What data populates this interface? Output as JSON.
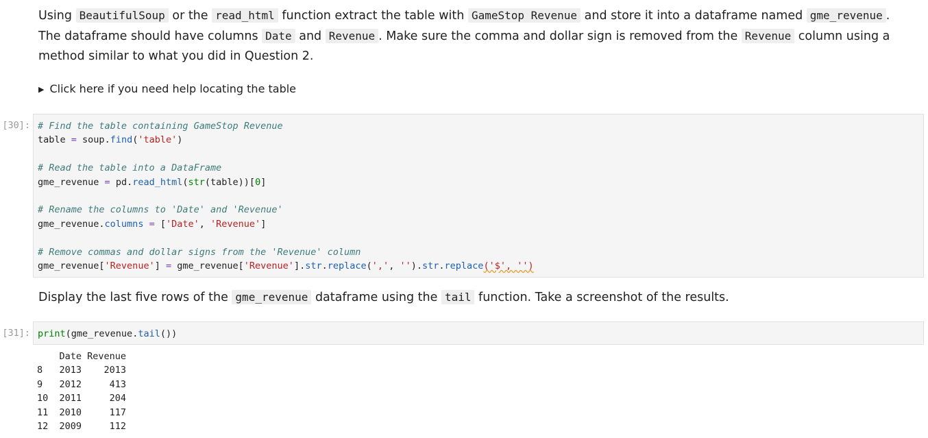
{
  "markdown1": {
    "t1": "Using ",
    "c1": "BeautifulSoup",
    "t2": " or the ",
    "c2": "read_html",
    "t3": " function extract the table with ",
    "c3": "GameStop Revenue",
    "t4": " and store it into a dataframe named ",
    "c4": "gme_revenue",
    "t5": ". The dataframe should have columns ",
    "c5": "Date",
    "t6": " and ",
    "c6": "Revenue",
    "t7": ". Make sure the comma and dollar sign is removed from the ",
    "c7": "Revenue",
    "t8": " column using a method similar to what you did in Question 2."
  },
  "details": {
    "summary": "Click here if you need help locating the table"
  },
  "cell30": {
    "prompt": "[30]:",
    "l1": "# Find the table containing GameStop Revenue",
    "l2a": "table ",
    "l2b": "=",
    "l2c": " soup",
    "l2d": ".",
    "l2e": "find",
    "l2f": "(",
    "l2g": "'table'",
    "l2h": ")",
    "l4": "# Read the table into a DataFrame",
    "l5a": "gme_revenue ",
    "l5b": "=",
    "l5c": " pd",
    "l5d": ".",
    "l5e": "read_html",
    "l5f": "(",
    "l5g": "str",
    "l5h": "(table))[",
    "l5i": "0",
    "l5j": "]",
    "l7": "# Rename the columns to 'Date' and 'Revenue'",
    "l8a": "gme_revenue",
    "l8b": ".",
    "l8c": "columns",
    "l8d": " = ",
    "l8e": "[",
    "l8f": "'Date'",
    "l8g": ", ",
    "l8h": "'Revenue'",
    "l8i": "]",
    "l10": "# Remove commas and dollar signs from the 'Revenue' column",
    "l11a": "gme_revenue[",
    "l11b": "'Revenue'",
    "l11c": "] ",
    "l11d": "=",
    "l11e": " gme_revenue[",
    "l11f": "'Revenue'",
    "l11g": "]",
    "l11h": ".",
    "l11i": "str",
    "l11j": ".",
    "l11k": "replace",
    "l11l": "(",
    "l11m": "','",
    "l11n": ", ",
    "l11o": "''",
    "l11p": ")",
    "l11q": ".",
    "l11r": "str",
    "l11s": ".",
    "l11t": "replace",
    "l11u": "('$', '')"
  },
  "markdown2": {
    "t1": "Display the last five rows of the ",
    "c1": "gme_revenue",
    "t2": " dataframe using the ",
    "c2": "tail",
    "t3": " function. Take a screenshot of the results."
  },
  "cell31": {
    "prompt": "[31]:",
    "a": "print",
    "b": "(gme_revenue",
    "c": ".",
    "d": "tail",
    "e": "())"
  },
  "output31": {
    "header": "    Date Revenue",
    "rows": [
      "8   2013    2013",
      "9   2012     413",
      "10  2011     204",
      "11  2010     117",
      "12  2009     112"
    ]
  }
}
